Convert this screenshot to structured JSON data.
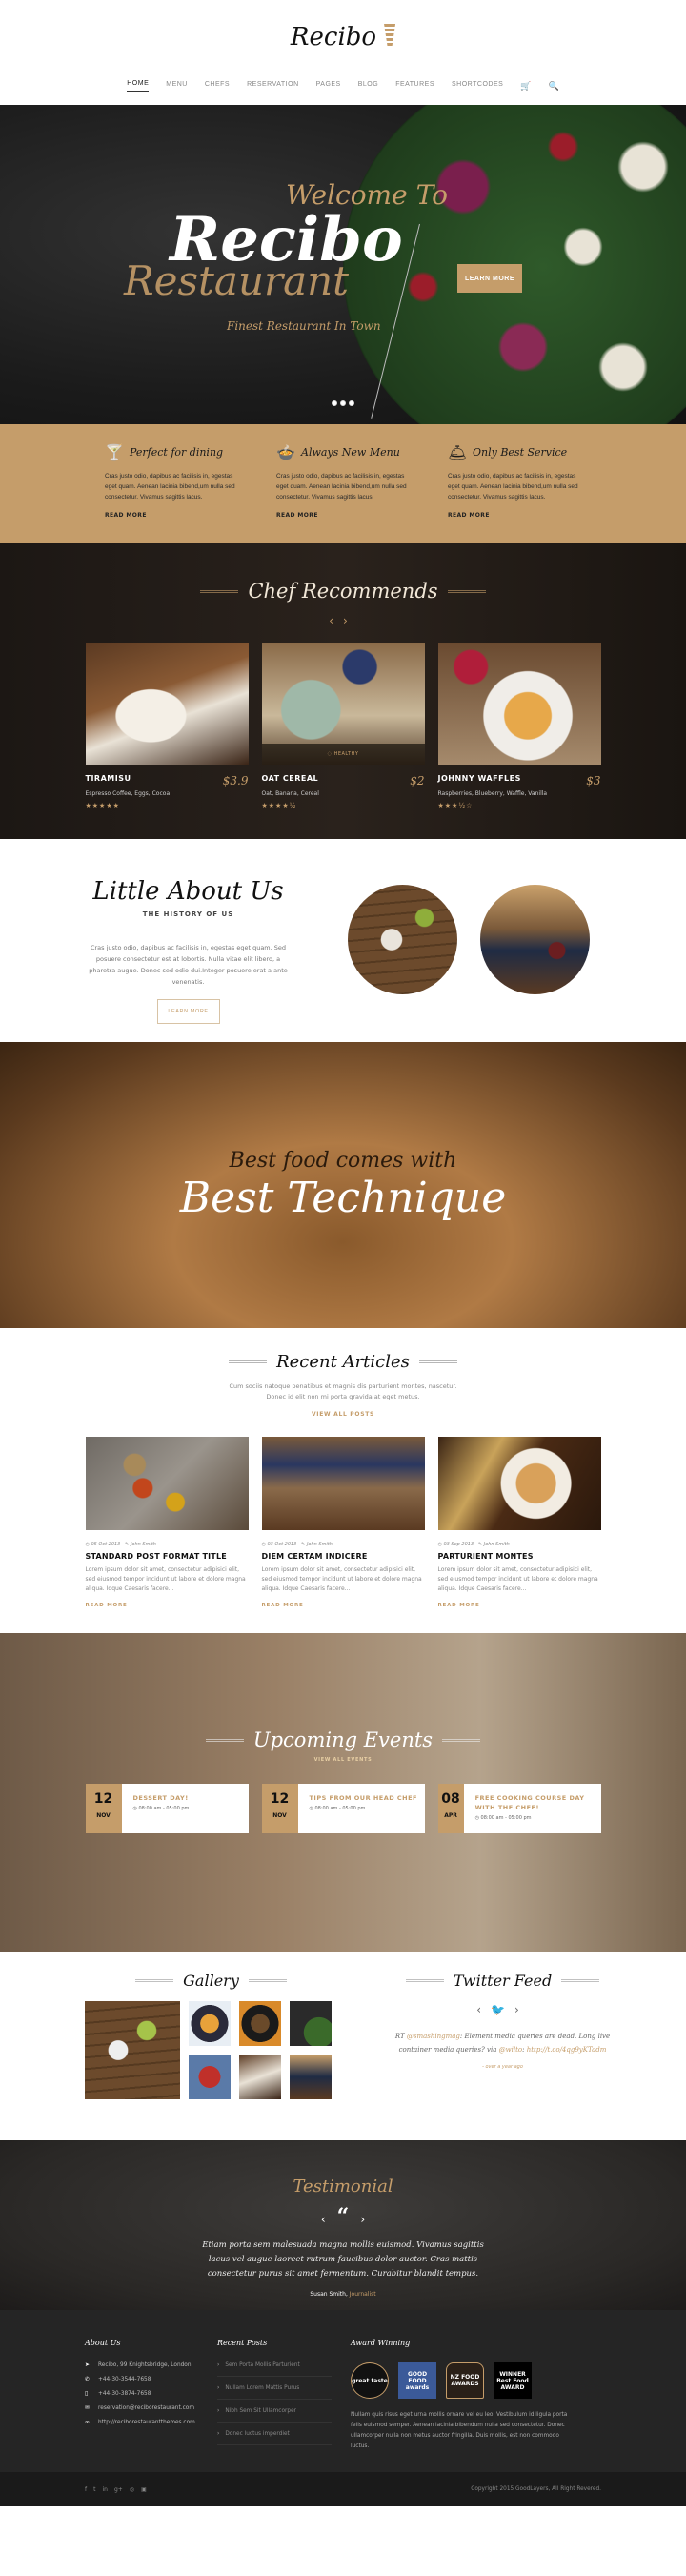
{
  "header": {
    "logo": "Recibo",
    "nav": [
      "HOME",
      "MENU",
      "CHEFS",
      "RESERVATION",
      "PAGES",
      "BLOG",
      "FEATURES",
      "SHORTCODES"
    ],
    "active": "HOME"
  },
  "hero": {
    "welcome": "Welcome To",
    "brand": "Recibo",
    "subtitle": "Restaurant",
    "tagline": "Finest Restaurant In Town",
    "button": "LEARN MORE",
    "slides": 3
  },
  "features": [
    {
      "icon": "cocktail-icon",
      "glyph": "🍸",
      "title": "Perfect for dining",
      "text": "Cras justo odio, dapibus ac facilisis in, egestas eget quam. Aenean lacinia bibend,um nulla sed consectetur. Vivamus sagittis lacus.",
      "link": "READ MORE"
    },
    {
      "icon": "bowl-icon",
      "glyph": "🍲",
      "title": "Always New Menu",
      "text": "Cras justo odio, dapibus ac facilisis in, egestas eget quam. Aenean lacinia bibend,um nulla sed consectetur. Vivamus sagittis lacus.",
      "link": "READ MORE"
    },
    {
      "icon": "cloche-icon",
      "glyph": "🛎",
      "title": "Only Best Service",
      "text": "Cras justo odio, dapibus ac facilisis in, egestas eget quam. Aenean lacinia bibend,um nulla sed consectetur. Vivamus sagittis lacus.",
      "link": "READ MORE"
    }
  ],
  "chef": {
    "title": "Chef Recommends",
    "dishes": [
      {
        "name": "TIRAMISU",
        "price": "$3.9",
        "ingredients": "Espresso Coffee, Eggs, Cocoa",
        "rating": 5,
        "stars": "★★★★★",
        "badge": ""
      },
      {
        "name": "OAT CEREAL",
        "price": "$2",
        "ingredients": "Oat, Banana, Cereal",
        "rating": 4.5,
        "stars": "★★★★½",
        "badge": "HEALTHY"
      },
      {
        "name": "JOHNNY WAFFLES",
        "price": "$3",
        "ingredients": "Raspberries, Blueberry, Waffle, Vanilla",
        "rating": 3.5,
        "stars": "★★★½☆",
        "badge": ""
      }
    ]
  },
  "about": {
    "title": "Little About Us",
    "subtitle": "THE HISTORY OF US",
    "text": "Cras justo odio, dapibus ac facilisis in, egestas eget quam. Sed posuere consectetur est at lobortis. Nulla vitae elit libero, a pharetra augue. Donec sed odio dui.Integer posuere erat a ante venenatis.",
    "button": "LEARN MORE"
  },
  "technique": {
    "line1": "Best food comes with",
    "line2": "Best Technique"
  },
  "articles": {
    "title": "Recent Articles",
    "intro": "Cum sociis natoque penatibus et magnis dis parturient montes, nascetur. Donec id elit non mi porta gravida at eget metus.",
    "view_all": "VIEW ALL POSTS",
    "items": [
      {
        "date": "05 Oct 2013",
        "author": "John Smith",
        "title": "STANDARD POST FORMAT TITLE",
        "excerpt": "Lorem ipsum dolor sit amet, consectetur adipisici elit, sed eiusmod tempor incidunt ut labore et dolore magna aliqua. Idque Caesaris facere...",
        "link": "READ MORE"
      },
      {
        "date": "03 Oct 2013",
        "author": "John Smith",
        "title": "DIEM CERTAM INDICERE",
        "excerpt": "Lorem ipsum dolor sit amet, consectetur adipisici elit, sed eiusmod tempor incidunt ut labore et dolore magna aliqua. Idque Caesaris facere...",
        "link": "READ MORE"
      },
      {
        "date": "03 Sep 2013",
        "author": "John Smith",
        "title": "PARTURIENT MONTES",
        "excerpt": "Lorem ipsum dolor sit amet, consectetur adipisici elit, sed eiusmod tempor incidunt ut labore et dolore magna aliqua. Idque Caesaris facere...",
        "link": "READ MORE"
      }
    ]
  },
  "events": {
    "title": "Upcoming Events",
    "view_all": "VIEW ALL EVENTS",
    "items": [
      {
        "day": "12",
        "month": "NOV",
        "title": "DESSERT DAY!",
        "time": "08:00 am - 05:00 pm"
      },
      {
        "day": "12",
        "month": "NOV",
        "title": "TIPS FROM OUR HEAD CHEF",
        "time": "08:00 am - 05:00 pm"
      },
      {
        "day": "08",
        "month": "APR",
        "title": "FREE COOKING COURSE DAY WITH THE CHEF!",
        "time": "08:00 am - 05:00 pm"
      }
    ]
  },
  "gallery": {
    "title": "Gallery",
    "count": 7
  },
  "twitter": {
    "title": "Twitter Feed",
    "prefix": "RT ",
    "handle1": "@smashingmag",
    "text1": ": Element media queries are dead. Long live container media queries? via ",
    "handle2": "@wilto",
    "text2": ": ",
    "link": "http://t.co/4qg9yKTadm",
    "ago": "- over a year ago"
  },
  "testimonial": {
    "title": "Testimonial",
    "quote": "Etiam porta sem malesuada magna mollis euismod. Vivamus sagittis lacus vel augue laoreet rutrum faucibus dolor auctor. Cras mattis consectetur purus sit amet fermentum. Curabitur blandit tempus.",
    "name": "Susan Smith",
    "role": "Journalist"
  },
  "footer": {
    "about_title": "About Us",
    "contacts": [
      {
        "icon": "location-icon",
        "glyph": "➤",
        "text": "Recibo, 99 Knightsbridge, London"
      },
      {
        "icon": "phone-icon",
        "glyph": "✆",
        "text": "+44-30-3544-7658"
      },
      {
        "icon": "mobile-icon",
        "glyph": "▯",
        "text": "+44-30-3874-7658"
      },
      {
        "icon": "mail-icon",
        "glyph": "✉",
        "text": "reservation@reciborestaurant.com"
      },
      {
        "icon": "link-icon",
        "glyph": "∞",
        "text": "http://reciborestaurantthemes.com"
      }
    ],
    "posts_title": "Recent Posts",
    "posts": [
      "Sem Porta Mollis Parturient",
      "Nullam Lorem Mattis Purus",
      "Nibh Sem Sit Ullamcorper",
      "Donec luctus imperdiet"
    ],
    "awards_title": "Award Winning",
    "awards": [
      "great taste",
      "GOOD FOOD awards",
      "NZ FOOD AWARDS",
      "WINNER Best Food AWARD"
    ],
    "awards_text": "Nullam quis risus eget urna mollis ornare vel eu leo. Vestibulum id ligula porta felis euismod semper. Aenean lacinia bibendum nulla sed consectetur. Donec ullamcorper nulla non metus auctor fringilla. Duis mollis, est non commodo luctus.",
    "social": [
      "f",
      "t",
      "in",
      "g+",
      "◎",
      "▣"
    ],
    "copyright": "Copyright 2015 GoodLayers, All Right Revered."
  }
}
